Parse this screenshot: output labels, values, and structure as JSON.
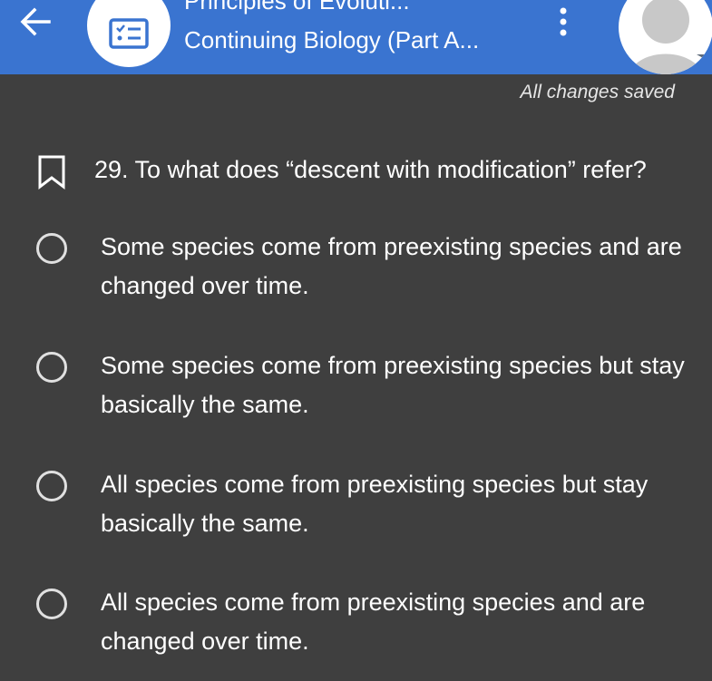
{
  "header": {
    "title_top": "Principles of Evoluti...",
    "title_main": "Continuing Biology (Part A...",
    "colors": {
      "background": "#3a74d0"
    }
  },
  "status": {
    "saved_text": "All changes saved"
  },
  "question": {
    "text": "29. To what does “descent with modification” refer?",
    "options": [
      {
        "text": "Some species come from preexisting species and are changed over time."
      },
      {
        "text": "Some species come from preexisting species but stay basically the same."
      },
      {
        "text": "All species come from preexisting species but stay basically the same."
      },
      {
        "text": "All species come from preexisting species and are changed over time."
      }
    ]
  },
  "icons": {
    "back": "arrow-left-icon",
    "document": "checklist-document-icon",
    "more": "more-vertical-icon",
    "avatar": "user-avatar-icon",
    "bookmark": "bookmark-outline-icon",
    "radio": "radio-unchecked-icon"
  },
  "theme": {
    "page_background": "#3f3f3f",
    "text": "#ffffff"
  }
}
